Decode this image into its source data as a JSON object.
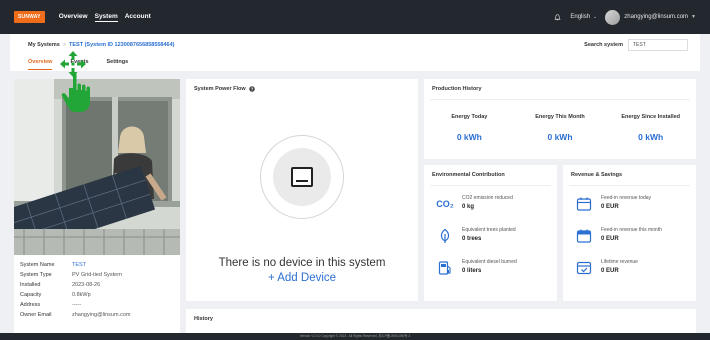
{
  "topbar": {
    "logo": "SUNWAY",
    "nav": [
      {
        "label": "Overview",
        "active": false
      },
      {
        "label": "System",
        "active": true
      },
      {
        "label": "Account",
        "active": false
      }
    ],
    "language": "English",
    "user_email": "zhangying@linsum.com"
  },
  "header": {
    "breadcrumb_root": "My Systems",
    "breadcrumb_separator": ">",
    "breadcrumb_current": "TEST (System ID 1230087656858558464)",
    "search_label": "Search system",
    "search_value": "TEST",
    "tabs": [
      {
        "label": "Overview",
        "active": true
      },
      {
        "label": "Events",
        "active": false
      },
      {
        "label": "Settings",
        "active": false
      }
    ]
  },
  "system_info": {
    "rows": [
      {
        "label": "System Name",
        "value": "TEST"
      },
      {
        "label": "System Type",
        "value": "PV Grid-tied System"
      },
      {
        "label": "Installed",
        "value": "2023-08-26"
      },
      {
        "label": "Capacity",
        "value": "0.8kWp"
      },
      {
        "label": "Address",
        "value": "-----"
      },
      {
        "label": "Owner Email",
        "value": "zhangying@linsum.com"
      }
    ]
  },
  "power_flow": {
    "title": "System Power Flow",
    "empty_message": "There is no device in this system",
    "add_device_label": "+ Add Device"
  },
  "production": {
    "title": "Production History",
    "columns": [
      {
        "label": "Energy Today",
        "value": "0 kWh"
      },
      {
        "label": "Energy This Month",
        "value": "0 kWh"
      },
      {
        "label": "Energy Since Installed",
        "value": "0 kWh"
      }
    ]
  },
  "environment": {
    "title": "Environmental Contribution",
    "co2_symbol": "CO₂",
    "items": [
      {
        "label": "CO2 emission reduced",
        "value": "0 kg",
        "icon": "co2-icon"
      },
      {
        "label": "Equivalent trees planted",
        "value": "0 trees",
        "icon": "leaf-icon"
      },
      {
        "label": "Equivalent diesel burned",
        "value": "0 liters",
        "icon": "fuel-pump-icon"
      }
    ]
  },
  "revenue": {
    "title": "Revenue & Savings",
    "items": [
      {
        "label": "Feed-in revenue today",
        "value": "0 EUR",
        "icon": "calendar-icon"
      },
      {
        "label": "Feed-in revenue this month",
        "value": "0 EUR",
        "icon": "calendar-month-icon"
      },
      {
        "label": "Lifetime revenue",
        "value": "0 EUR",
        "icon": "checklist-icon"
      }
    ]
  },
  "history": {
    "title": "History"
  },
  "footer": {
    "text": "Version V1.0.0    Copyright © 2023 . All Rights Reserved.    苏ICP备19001490号-3"
  },
  "colors": {
    "accent_blue": "#2c6fd1",
    "accent_orange": "#e3691f",
    "topbar": "#23272e",
    "cursor_green": "#23a638"
  }
}
